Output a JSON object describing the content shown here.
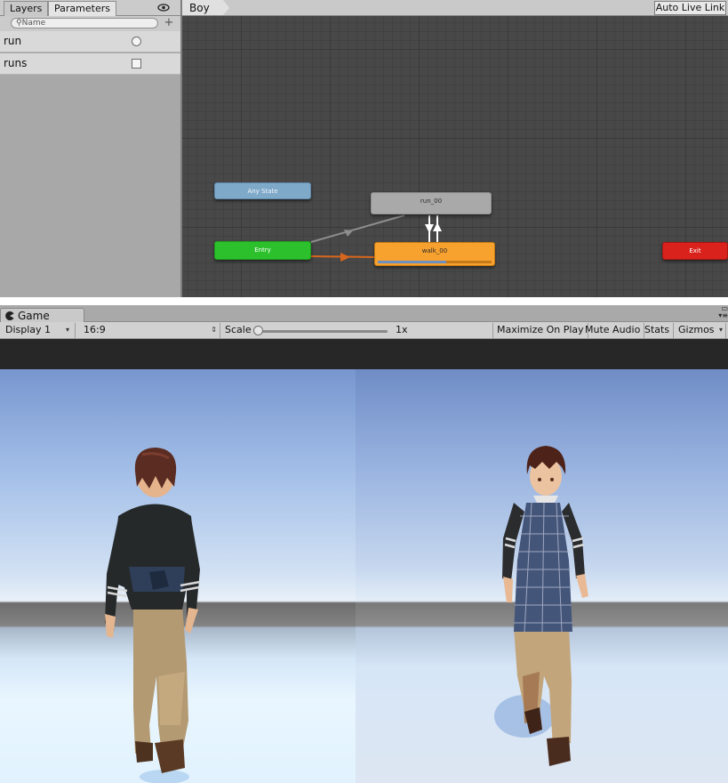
{
  "animator": {
    "tabs": {
      "layers": "Layers",
      "parameters": "Parameters"
    },
    "search": {
      "placeholder": "Name"
    },
    "add_button": "+",
    "parameters": [
      {
        "name": "run",
        "type": "trigger"
      },
      {
        "name": "runs",
        "type": "bool"
      }
    ],
    "breadcrumb": "Boy",
    "auto_live_link": "Auto Live Link",
    "states": {
      "any": "Any State",
      "entry": "Entry",
      "run": "run_00",
      "walk": "walk_00",
      "exit": "Exit"
    },
    "walk_progress_fraction": 0.6,
    "colors": {
      "any_state": "#7fa9c9",
      "entry": "#2cc12c",
      "default_state": "#f7a12e",
      "state": "#a9a9a9",
      "exit": "#d9221c",
      "default_transition": "#d7661d",
      "transition": "#8e8e8e"
    }
  },
  "game": {
    "tab": "Game",
    "display": "Display 1",
    "aspect": "16:9",
    "scale_label": "Scale",
    "scale_value": "1x",
    "buttons": {
      "maximize": "Maximize On Play",
      "mute": "Mute Audio",
      "stats": "Stats",
      "gizmos": "Gizmos"
    }
  }
}
